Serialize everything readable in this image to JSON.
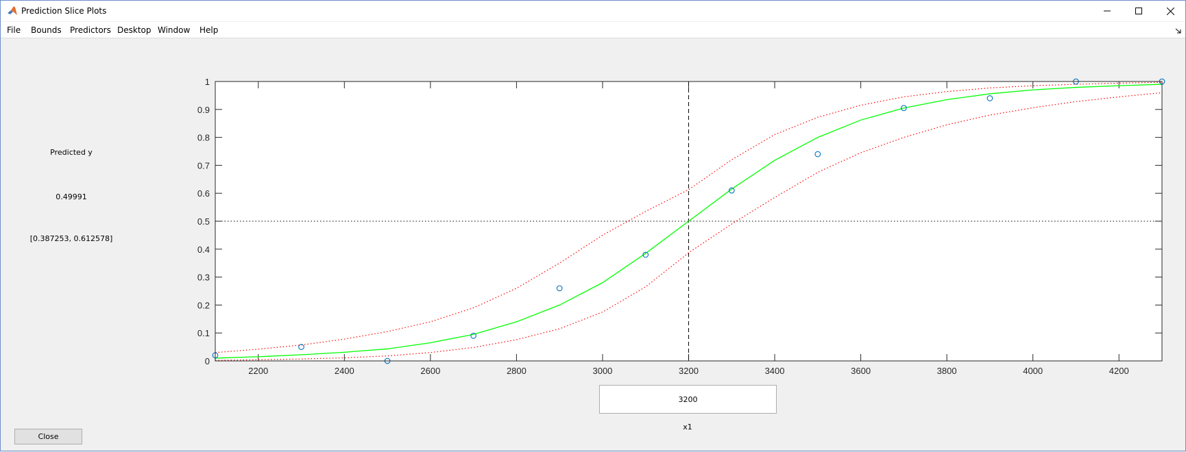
{
  "window": {
    "title": "Prediction Slice Plots",
    "minimize_icon": "minimize-icon",
    "maximize_icon": "maximize-icon",
    "close_icon": "close-icon",
    "app_icon": "matlab-logo-icon"
  },
  "menu": {
    "items": [
      "File",
      "Bounds",
      "Predictors",
      "Desktop",
      "Window",
      "Help"
    ],
    "dock_icon": "dock-arrow-icon"
  },
  "side_panel": {
    "label": "Predicted y",
    "value": "0.49991",
    "interval": "[0.387253, 0.612578]"
  },
  "predictor": {
    "value": "3200",
    "name": "x1"
  },
  "close_button": {
    "label": "Close"
  },
  "chart_data": {
    "type": "line",
    "xlim": [
      2100,
      4300
    ],
    "ylim": [
      0,
      1
    ],
    "xticks": [
      2200,
      2400,
      2600,
      2800,
      3000,
      3200,
      3400,
      3600,
      3800,
      4000,
      4200
    ],
    "xtick_labels": [
      "2200",
      "2400",
      "2600",
      "2800",
      "3000",
      "3200",
      "3400",
      "3600",
      "3800",
      "4000",
      "4200"
    ],
    "yticks": [
      0,
      0.1,
      0.2,
      0.3,
      0.4,
      0.5,
      0.6,
      0.7,
      0.8,
      0.9,
      1
    ],
    "ytick_labels": [
      "0",
      "0.1",
      "0.2",
      "0.3",
      "0.4",
      "0.5",
      "0.6",
      "0.7",
      "0.8",
      "0.9",
      "1"
    ],
    "grid": false,
    "crosshair": {
      "x": 3200,
      "y": 0.49991
    },
    "fit": {
      "color": "#00ff00",
      "x": [
        2100,
        2200,
        2300,
        2400,
        2500,
        2600,
        2700,
        2800,
        2900,
        3000,
        3100,
        3200,
        3300,
        3400,
        3500,
        3600,
        3700,
        3800,
        3900,
        4000,
        4100,
        4200,
        4300
      ],
      "y": [
        0.01,
        0.015,
        0.022,
        0.031,
        0.043,
        0.065,
        0.095,
        0.14,
        0.2,
        0.28,
        0.385,
        0.5,
        0.615,
        0.718,
        0.8,
        0.862,
        0.905,
        0.935,
        0.956,
        0.97,
        0.979,
        0.985,
        0.99
      ]
    },
    "upper_bound": {
      "color": "#ff0000",
      "x": [
        2100,
        2200,
        2300,
        2400,
        2500,
        2600,
        2700,
        2800,
        2900,
        3000,
        3100,
        3200,
        3300,
        3400,
        3500,
        3600,
        3700,
        3800,
        3900,
        4000,
        4100,
        4200,
        4300
      ],
      "y": [
        0.03,
        0.042,
        0.057,
        0.078,
        0.105,
        0.14,
        0.19,
        0.26,
        0.35,
        0.45,
        0.535,
        0.613,
        0.72,
        0.81,
        0.872,
        0.915,
        0.945,
        0.964,
        0.977,
        0.985,
        0.99,
        0.994,
        0.997
      ]
    },
    "lower_bound": {
      "color": "#ff0000",
      "x": [
        2100,
        2200,
        2300,
        2400,
        2500,
        2600,
        2700,
        2800,
        2900,
        3000,
        3100,
        3200,
        3300,
        3400,
        3500,
        3600,
        3700,
        3800,
        3900,
        4000,
        4100,
        4200,
        4300
      ],
      "y": [
        0.002,
        0.004,
        0.007,
        0.011,
        0.018,
        0.03,
        0.048,
        0.076,
        0.115,
        0.175,
        0.265,
        0.387,
        0.49,
        0.585,
        0.675,
        0.745,
        0.8,
        0.845,
        0.88,
        0.906,
        0.928,
        0.945,
        0.96
      ]
    },
    "observations": {
      "color": "#0072bd",
      "x": [
        2100,
        2300,
        2500,
        2700,
        2900,
        3100,
        3300,
        3500,
        3700,
        3900,
        4100,
        4300
      ],
      "y": [
        0.02,
        0.05,
        0.0,
        0.09,
        0.26,
        0.38,
        0.61,
        0.74,
        0.905,
        0.94,
        1.0,
        1.0
      ]
    }
  }
}
